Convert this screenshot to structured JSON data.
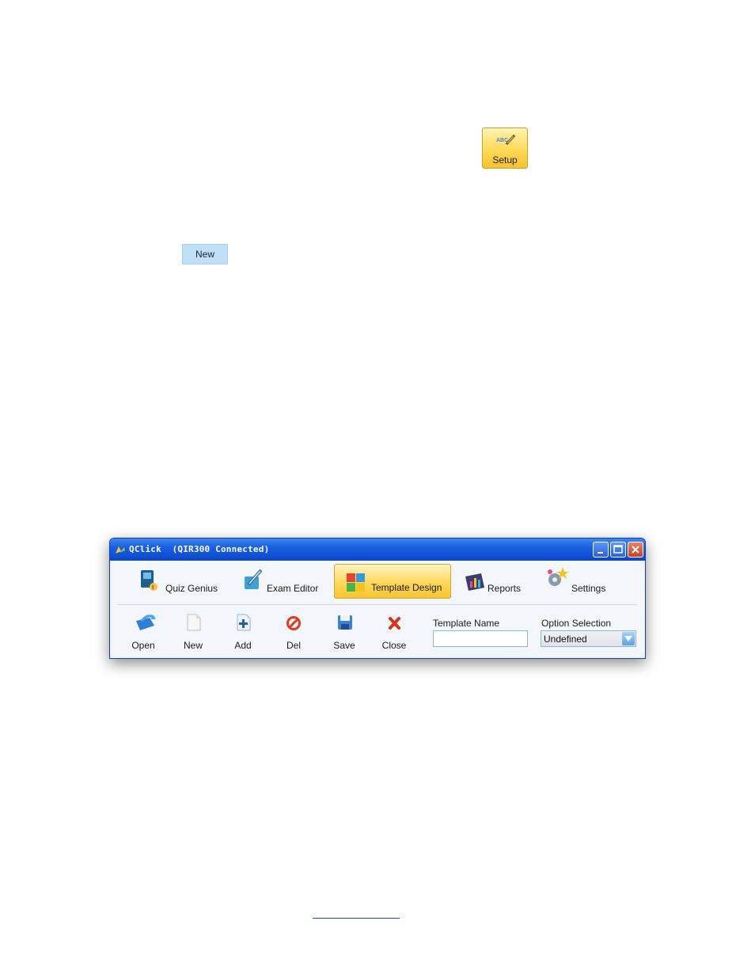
{
  "inline_buttons": {
    "setup_label": "Setup",
    "new_label": "New"
  },
  "window": {
    "title": "QClick  (QIR300 Connected)",
    "tabs": [
      {
        "label": "Quiz Genius",
        "icon": "quiz-genius-icon"
      },
      {
        "label": "Exam Editor",
        "icon": "exam-editor-icon"
      },
      {
        "label": "Template Design",
        "icon": "template-design-icon",
        "active": true
      },
      {
        "label": "Reports",
        "icon": "reports-icon"
      },
      {
        "label": "Settings",
        "icon": "settings-icon"
      }
    ],
    "toolbar": {
      "open_label": "Open",
      "new_label": "New",
      "add_label": "Add",
      "del_label": "Del",
      "save_label": "Save",
      "close_label": "Close"
    },
    "template_name": {
      "label": "Template Name",
      "value": ""
    },
    "option_selection": {
      "label": "Option Selection",
      "value": "Undefined"
    }
  },
  "colors": {
    "titlebar": "#1a5fe0",
    "active_tab": "#ffd85a",
    "setup_button": "#ffd84f",
    "new_button": "#bfe0f6"
  }
}
